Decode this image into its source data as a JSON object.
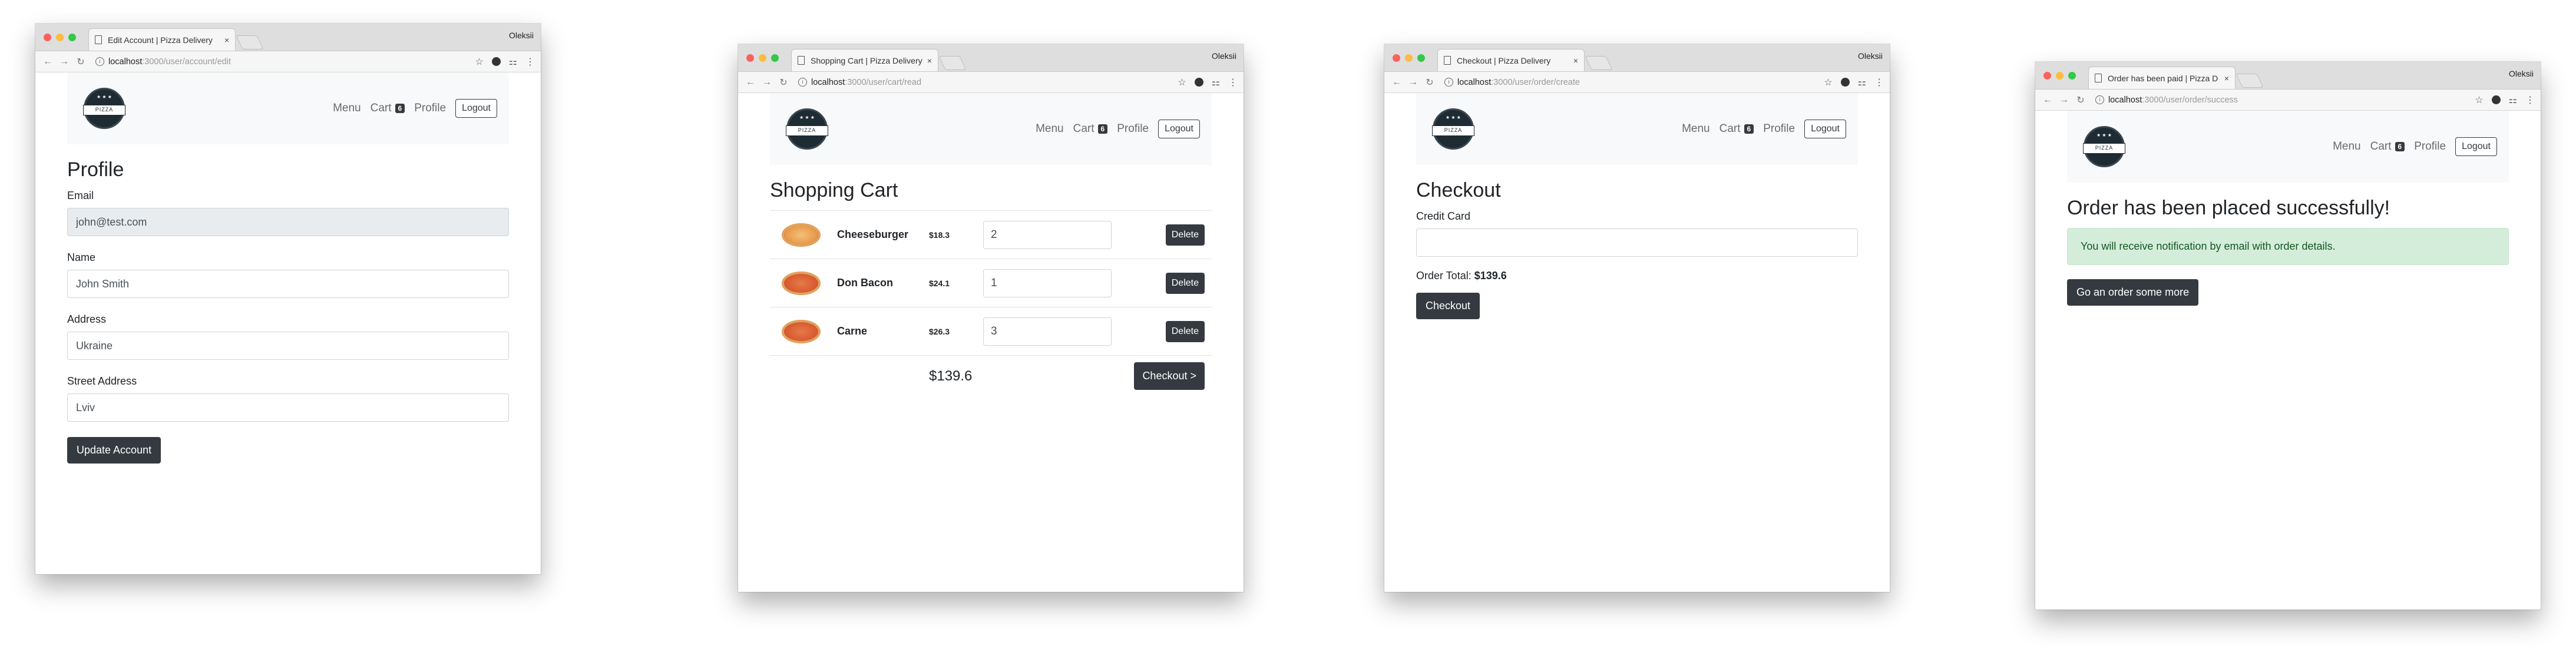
{
  "windows": [
    {
      "tab_title": "Edit Account | Pizza Delivery",
      "user": "Oleksii",
      "url_host": "localhost",
      "url_path": ":3000/user/account/edit"
    },
    {
      "tab_title": "Shopping Cart | Pizza Delivery",
      "user": "Oleksii",
      "url_host": "localhost",
      "url_path": ":3000/user/cart/read"
    },
    {
      "tab_title": "Checkout | Pizza Delivery",
      "user": "Oleksii",
      "url_host": "localhost",
      "url_path": ":3000/user/order/create"
    },
    {
      "tab_title": "Order has been paid | Pizza D",
      "user": "Oleksii",
      "url_host": "localhost",
      "url_path": ":3000/user/order/success"
    }
  ],
  "nav": {
    "logo_text": "PIZZA",
    "menu": "Menu",
    "cart": "Cart",
    "cart_count": "6",
    "profile": "Profile",
    "logout": "Logout"
  },
  "profile_page": {
    "title": "Profile",
    "email_label": "Email",
    "email_value": "john@test.com",
    "name_label": "Name",
    "name_value": "John Smith",
    "address_label": "Address",
    "address_value": "Ukraine",
    "street_label": "Street Address",
    "street_value": "Lviv",
    "submit": "Update Account"
  },
  "cart_page": {
    "title": "Shopping Cart",
    "items": [
      {
        "name": "Cheeseburger",
        "price": "$18.3",
        "qty": "2",
        "delete": "Delete"
      },
      {
        "name": "Don Bacon",
        "price": "$24.1",
        "qty": "1",
        "delete": "Delete"
      },
      {
        "name": "Carne",
        "price": "$26.3",
        "qty": "3",
        "delete": "Delete"
      }
    ],
    "total": "$139.6",
    "checkout": "Checkout >"
  },
  "checkout_page": {
    "title": "Checkout",
    "card_label": "Credit Card",
    "card_value": "",
    "total_label": "Order Total:",
    "total_value": "$139.6",
    "submit": "Checkout"
  },
  "success_page": {
    "title": "Order has been placed successfully!",
    "alert": "You will receive notification by email with order details.",
    "button": "Go an order some more"
  }
}
